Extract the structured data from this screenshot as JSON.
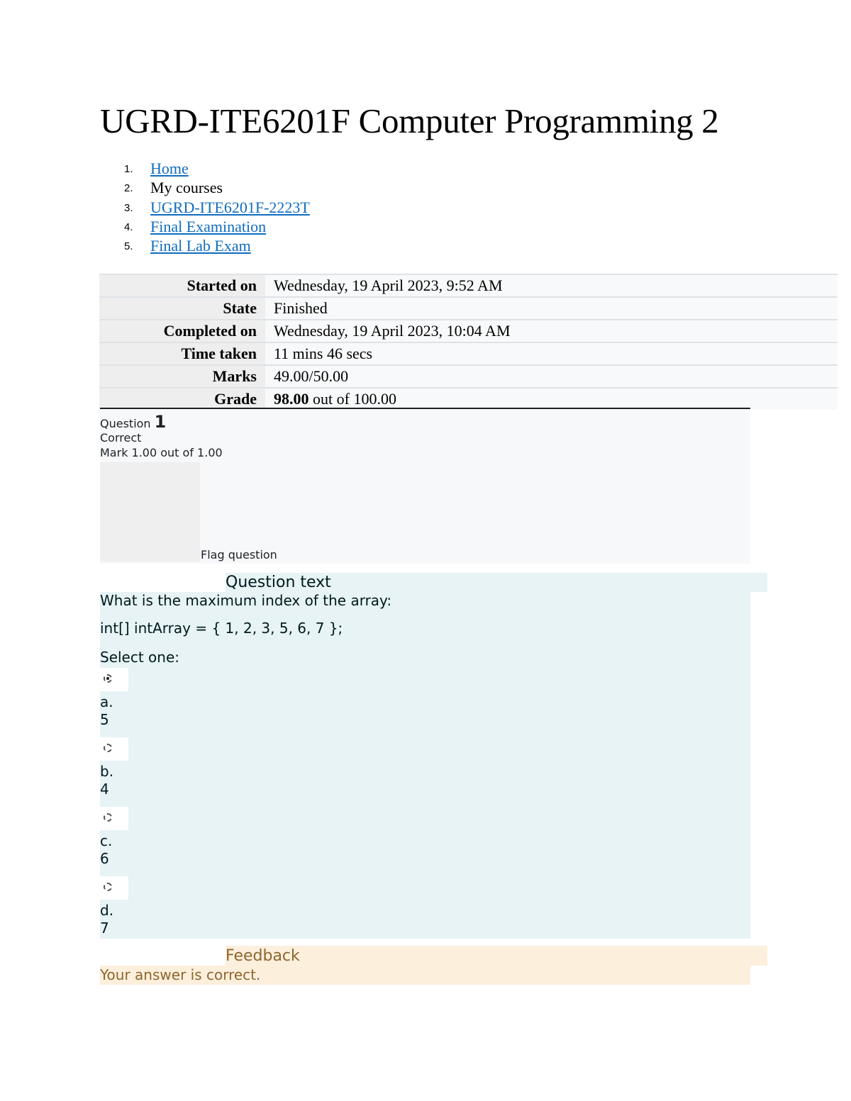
{
  "page": {
    "title": "UGRD-ITE6201F Computer Programming 2"
  },
  "breadcrumb": [
    {
      "num": "1.",
      "label": "Home",
      "link": true
    },
    {
      "num": "2.",
      "label": "My courses",
      "link": false
    },
    {
      "num": "3.",
      "label": "UGRD-ITE6201F-2223T",
      "link": true
    },
    {
      "num": "4.",
      "label": "Final Examination",
      "link": true
    },
    {
      "num": "5.",
      "label": "Final Lab Exam",
      "link": true
    }
  ],
  "summary": {
    "started_on": {
      "label": "Started on",
      "value": "Wednesday, 19 April 2023, 9:52 AM"
    },
    "state": {
      "label": "State",
      "value": "Finished"
    },
    "completed_on": {
      "label": "Completed on",
      "value": "Wednesday, 19 April 2023, 10:04 AM"
    },
    "time_taken": {
      "label": "Time taken",
      "value": "11 mins 46 secs"
    },
    "marks": {
      "label": "Marks",
      "value": "49.00/50.00"
    },
    "grade": {
      "label": "Grade",
      "value_bold": "98.00",
      "value_rest": " out of 100.00"
    }
  },
  "question": {
    "prefix": "Question",
    "number": "1",
    "state": "Correct",
    "grade": "Mark 1.00 out of 1.00",
    "flag_label": "Flag question",
    "text_heading": "Question text",
    "prompt": "What is the maximum index of the array:",
    "code": "int[] intArray = { 1, 2, 3, 5, 6, 7 };",
    "select_prompt": "Select one:",
    "options": [
      {
        "letter": "a.",
        "value": "5",
        "checked": true
      },
      {
        "letter": "b.",
        "value": "4",
        "checked": false
      },
      {
        "letter": "c.",
        "value": "6",
        "checked": false
      },
      {
        "letter": "d.",
        "value": "7",
        "checked": false
      }
    ]
  },
  "feedback": {
    "heading": "Feedback",
    "text": "Your answer is correct."
  },
  "colors": {
    "link": "#0f6cbf",
    "question_bg": "#e7f3f5",
    "feedback_bg": "#fcefdc",
    "feedback_text": "#8e662e"
  }
}
